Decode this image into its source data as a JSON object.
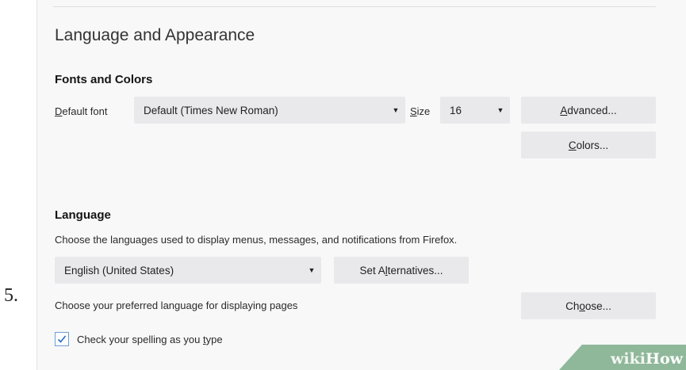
{
  "step": "5.",
  "section_title": "Language and Appearance",
  "fonts": {
    "heading": "Fonts and Colors",
    "default_font_label": "Default font",
    "default_font_value": "Default (Times New Roman)",
    "size_label": "Size",
    "size_value": "16",
    "advanced_button": "Advanced...",
    "colors_button": "Colors..."
  },
  "language": {
    "heading": "Language",
    "description": "Choose the languages used to display menus, messages, and notifications from Firefox.",
    "selected_language": "English (United States)",
    "set_alternatives_button": "Set Alternatives...",
    "pages_prompt": "Choose your preferred language for displaying pages",
    "choose_button": "Choose...",
    "spellcheck_label": "Check your spelling as you type",
    "spellcheck_checked": true
  },
  "watermark": {
    "wiki": "wiki",
    "how": "How"
  }
}
